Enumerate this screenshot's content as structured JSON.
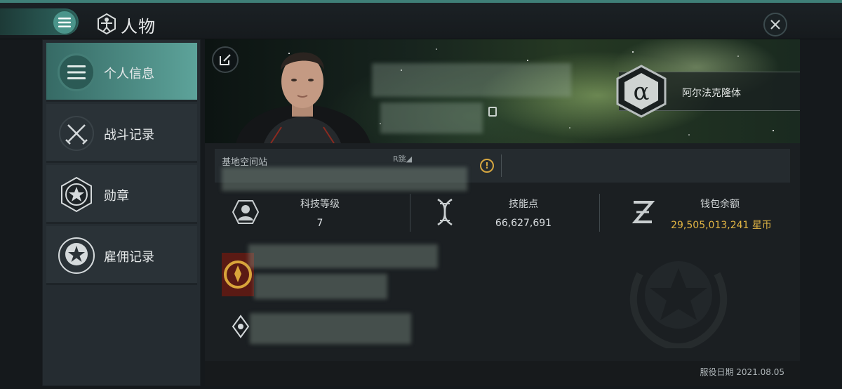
{
  "header": {
    "title": "人物",
    "menu_icon": "hamburger-icon",
    "title_icon": "vitruvian-person-icon",
    "close_icon": "close-icon"
  },
  "sidebar": {
    "items": [
      {
        "label": "个人信息",
        "icon": "list-icon",
        "active": true
      },
      {
        "label": "战斗记录",
        "icon": "crossed-swords-icon",
        "active": false
      },
      {
        "label": "勋章",
        "icon": "star-hexagon-icon",
        "active": false
      },
      {
        "label": "雇佣记录",
        "icon": "star-laurel-icon",
        "active": false
      }
    ]
  },
  "profile": {
    "corporation_symbol": "α",
    "corporation_name": "阿尔法克隆体",
    "station_label": "基地空间站",
    "station_extra": "R跳◢",
    "warning_symbol": "!"
  },
  "stats": [
    {
      "label": "科技等级",
      "value": "7",
      "icon": "person-badge-icon"
    },
    {
      "label": "技能点",
      "value": "66,627,691",
      "icon": "dna-icon"
    },
    {
      "label": "钱包余额",
      "value": "29,505,013,241 星币",
      "icon": "z-currency-icon"
    }
  ],
  "footer": {
    "service_date": "服役日期 2021.08.05"
  },
  "colors": {
    "accent": "#4b958b",
    "gold": "#e2b544",
    "background": "#15191c"
  }
}
